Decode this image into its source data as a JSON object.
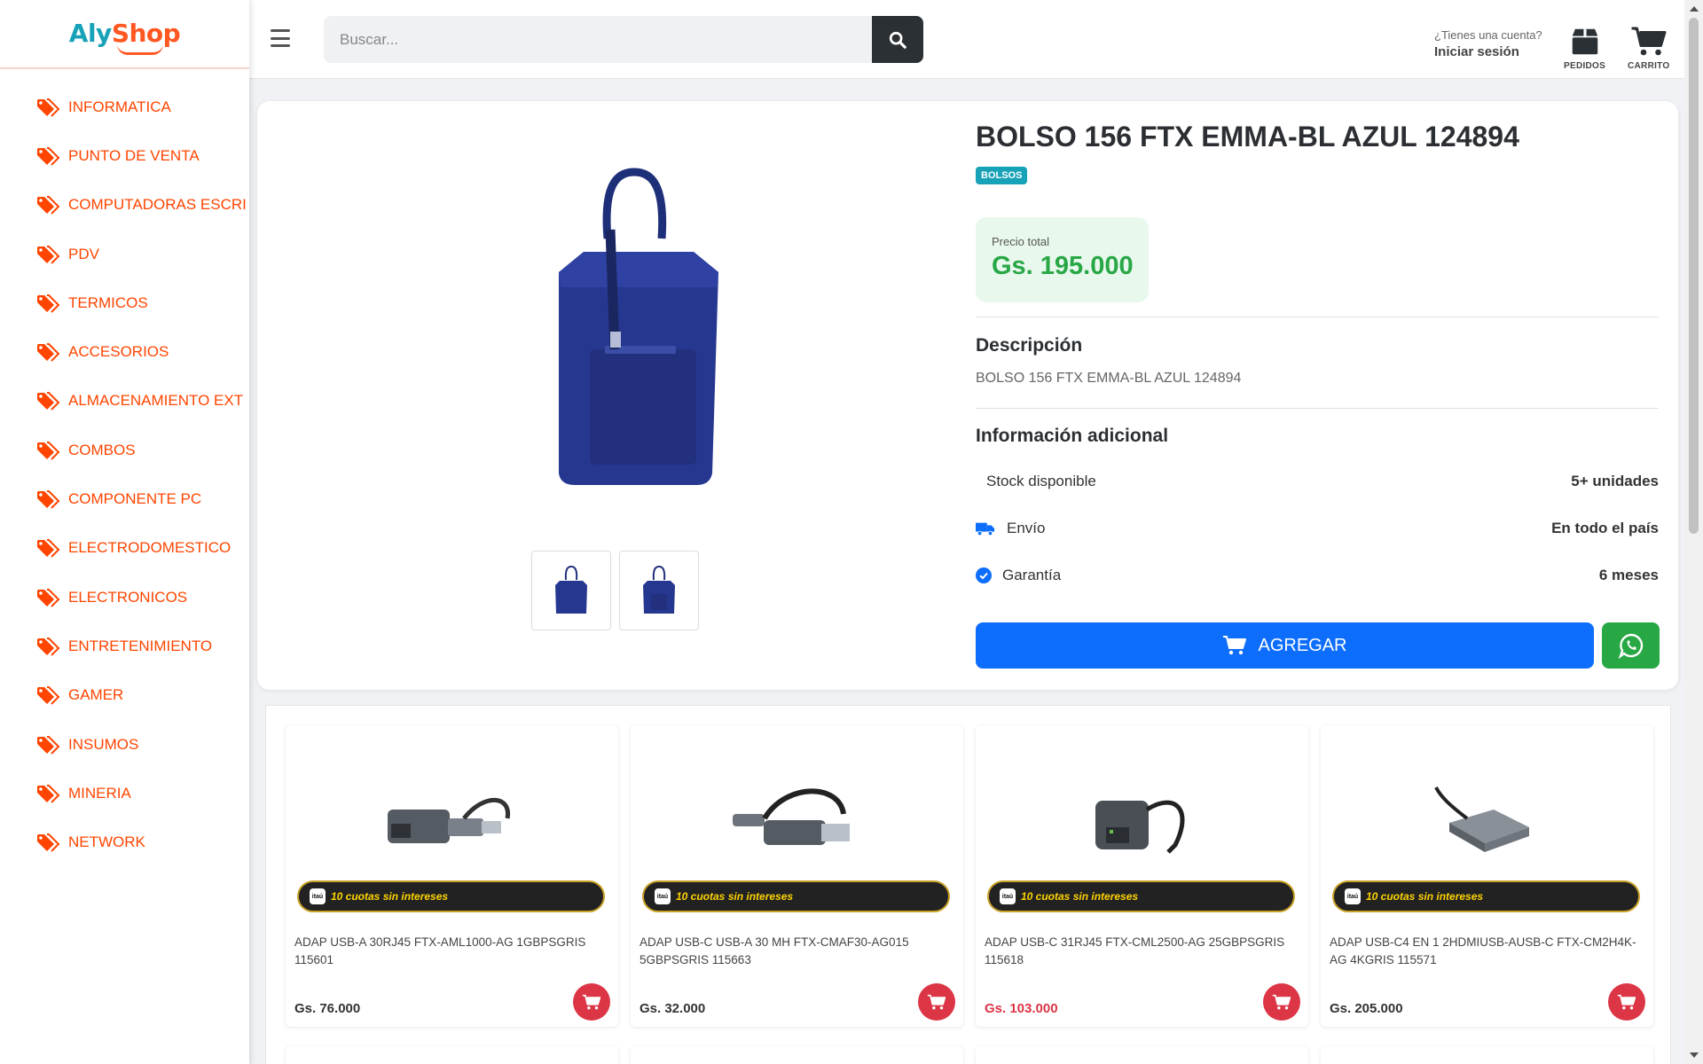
{
  "brand": {
    "logo_left": "Aly",
    "logo_right": "Shop"
  },
  "colors": {
    "accent_orange": "#ff4500",
    "teal": "#17a2b8",
    "blue": "#0d6efd",
    "green": "#28a745",
    "red": "#dc3545"
  },
  "sidebar": {
    "items": [
      {
        "label": "INFORMATICA"
      },
      {
        "label": "PUNTO DE VENTA"
      },
      {
        "label": "COMPUTADORAS ESCRITORIO"
      },
      {
        "label": "PDV"
      },
      {
        "label": "TERMICOS"
      },
      {
        "label": "ACCESORIOS"
      },
      {
        "label": "ALMACENAMIENTO EXT"
      },
      {
        "label": "COMBOS"
      },
      {
        "label": "COMPONENTE PC"
      },
      {
        "label": "ELECTRODOMESTICO"
      },
      {
        "label": "ELECTRONICOS"
      },
      {
        "label": "ENTRETENIMIENTO"
      },
      {
        "label": "GAMER"
      },
      {
        "label": "INSUMOS"
      },
      {
        "label": "MINERIA"
      },
      {
        "label": "NETWORK"
      }
    ]
  },
  "header": {
    "search_placeholder": "Buscar...",
    "account_question": "¿Tienes una cuenta?",
    "login_label": "Iniciar sesión",
    "orders_label": "PEDIDOS",
    "cart_label": "CARRITO"
  },
  "product": {
    "title": "BOLSO 156 FTX EMMA-BL AZUL 124894",
    "category_badge": "BOLSOS",
    "price_label": "Precio total",
    "price": "Gs. 195.000",
    "description_title": "Descripción",
    "description": "BOLSO 156 FTX EMMA-BL AZUL 124894",
    "additional_title": "Información adicional",
    "stock_label": "Stock disponible",
    "stock_value": "5+ unidades",
    "shipping_label": "Envío",
    "shipping_value": "En todo el país",
    "warranty_label": "Garantía",
    "warranty_value": "6 meses",
    "add_button": "AGREGAR"
  },
  "related": {
    "promo_text": "10 cuotas sin intereses",
    "promo_brand": "itaú",
    "products": [
      {
        "name": "ADAP USB-A 30RJ45 FTX-AML1000-AG 1GBPSGRIS 115601",
        "price": "Gs. 76.000"
      },
      {
        "name": "ADAP USB-C USB-A 30 MH FTX-CMAF30-AG015 5GBPSGRIS 115663",
        "price": "Gs. 32.000"
      },
      {
        "name": "ADAP USB-C 31RJ45 FTX-CML2500-AG 25GBPSGRIS 115618",
        "price": "Gs. 103.000"
      },
      {
        "name": "ADAP USB-C4 EN 1 2HDMIUSB-AUSB-C FTX-CM2H4K-AG 4KGRIS 115571",
        "price": "Gs. 205.000"
      }
    ]
  }
}
